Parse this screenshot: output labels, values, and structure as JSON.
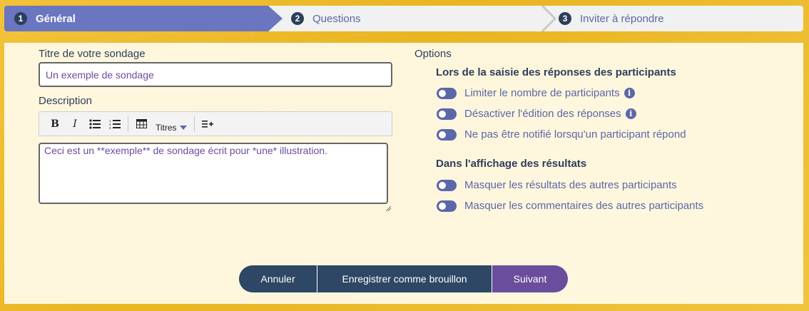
{
  "stepper": {
    "steps": [
      {
        "num": "1",
        "label": "Général"
      },
      {
        "num": "2",
        "label": "Questions"
      },
      {
        "num": "3",
        "label": "Inviter à répondre"
      }
    ]
  },
  "form": {
    "title_label": "Titre de votre sondage",
    "title_value": "Un exemple de sondage",
    "description_label": "Description",
    "toolbar": {
      "bold": "B",
      "italic": "I",
      "headings": "Titres"
    },
    "description_value": "Ceci est un **exemple** de sondage écrit pour *une* illustration."
  },
  "options": {
    "title": "Options",
    "section1": {
      "title": "Lors de la saisie des réponses des participants",
      "items": [
        {
          "label": "Limiter le nombre de participants",
          "info": true
        },
        {
          "label": "Désactiver l'édition des réponses",
          "info": true
        },
        {
          "label": "Ne pas être notifié lorsqu'un participant répond",
          "info": false
        }
      ]
    },
    "section2": {
      "title": "Dans l'affichage des résultats",
      "items": [
        {
          "label": "Masquer les résultats des autres participants"
        },
        {
          "label": "Masquer les commentaires des autres participants"
        }
      ]
    }
  },
  "actions": {
    "cancel": "Annuler",
    "draft": "Enregistrer comme brouillon",
    "next": "Suivant"
  },
  "colors": {
    "active_step": "#6a76c0",
    "primary_dark": "#2d4764",
    "accent_purple": "#6a4d9c",
    "toggle": "#5b67a8"
  }
}
